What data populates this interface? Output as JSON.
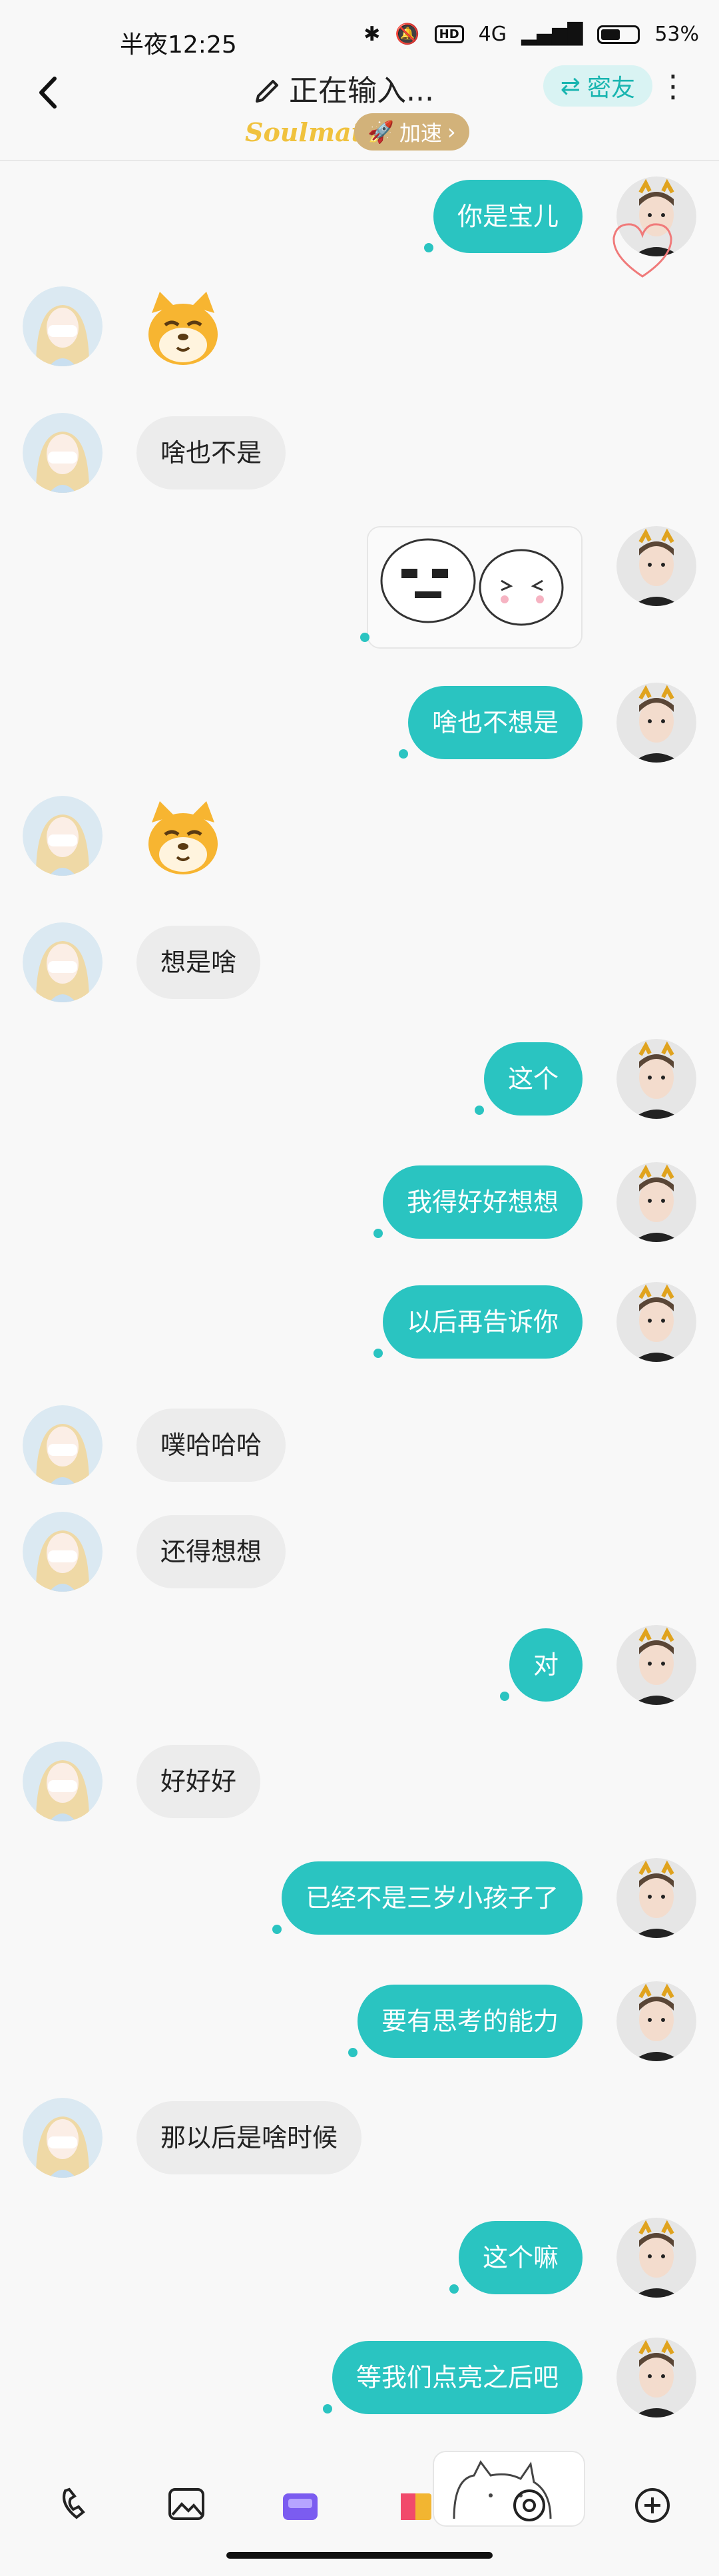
{
  "status_bar": {
    "time": "半夜12:25",
    "network": "4G",
    "hd": "HD",
    "battery_pct_text": "53%",
    "battery_level": 0.53
  },
  "header": {
    "title": "正在输入...",
    "friend_pill": "密友",
    "brand": "Soulmate",
    "speed_pill": "加速"
  },
  "messages": [
    {
      "side": "right",
      "text": "你是宝儿"
    },
    {
      "side": "left",
      "emoji": "dog-face"
    },
    {
      "side": "left",
      "text": "啥也不是"
    },
    {
      "side": "right",
      "sticker": "meme-sticker"
    },
    {
      "side": "right",
      "text": "啥也不想是"
    },
    {
      "side": "left",
      "emoji": "dog-face"
    },
    {
      "side": "left",
      "text": "想是啥"
    },
    {
      "side": "right",
      "text": "这个"
    },
    {
      "side": "right",
      "text": "我得好好想想"
    },
    {
      "side": "right",
      "text": "以后再告诉你"
    },
    {
      "side": "left",
      "text": "噗哈哈哈"
    },
    {
      "side": "left",
      "text": "还得想想"
    },
    {
      "side": "right",
      "text": "对"
    },
    {
      "side": "left",
      "text": "好好好"
    },
    {
      "side": "right",
      "text": "已经不是三岁小孩子了"
    },
    {
      "side": "right",
      "text": "要有思考的能力"
    },
    {
      "side": "left",
      "text": "那以后是啥时候"
    },
    {
      "side": "right",
      "text": "这个嘛"
    },
    {
      "side": "right",
      "text": "等我们点亮之后吧"
    }
  ],
  "colors": {
    "accent": "#2ac4c1",
    "left_bubble": "#ececec",
    "gold": "#d2b27a"
  },
  "toolbar_icons": [
    "phone-icon",
    "image-icon",
    "soul-gift-icon",
    "gift-box-icon",
    "camera-icon",
    "plus-icon"
  ]
}
